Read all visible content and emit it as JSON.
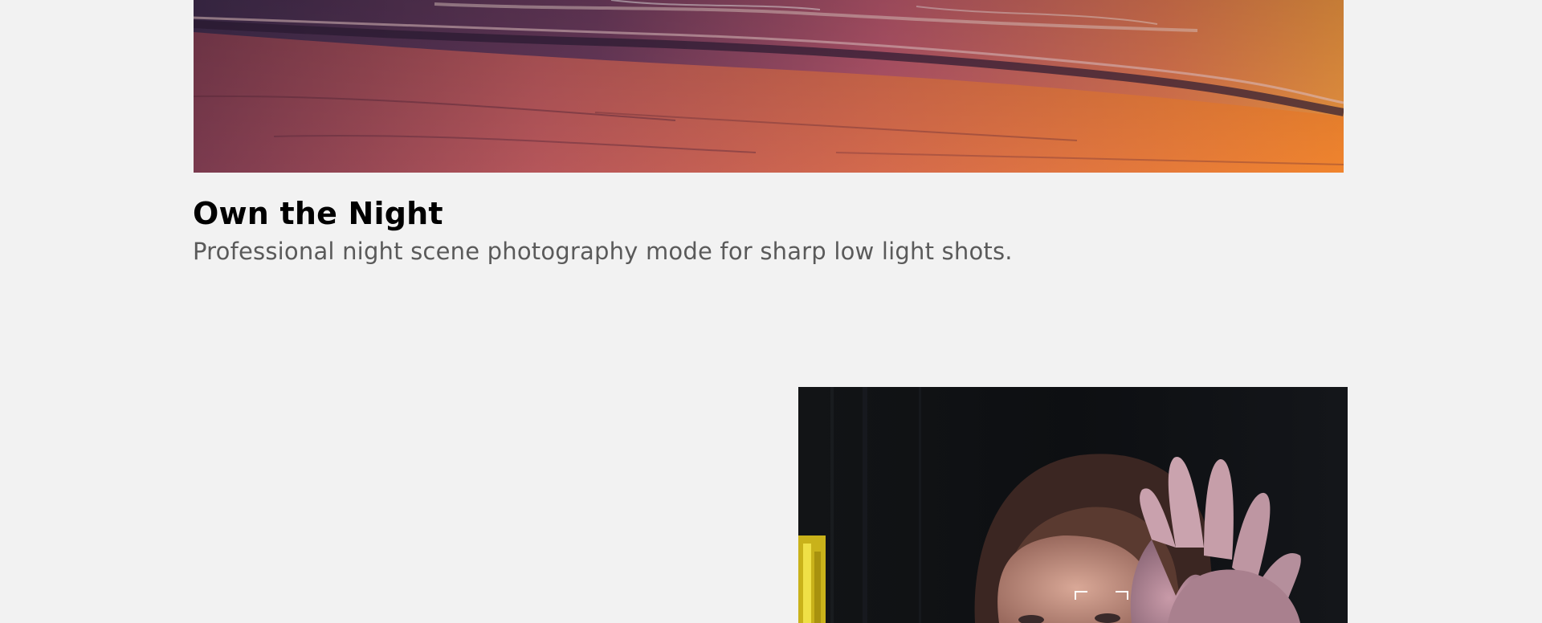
{
  "feature": {
    "title": "Own the Night",
    "description": "Professional night scene photography mode for sharp low light shots."
  },
  "images": {
    "beach": "sunset-beach-waves-photo",
    "portrait": "portrait-with-raised-hand-photo"
  }
}
